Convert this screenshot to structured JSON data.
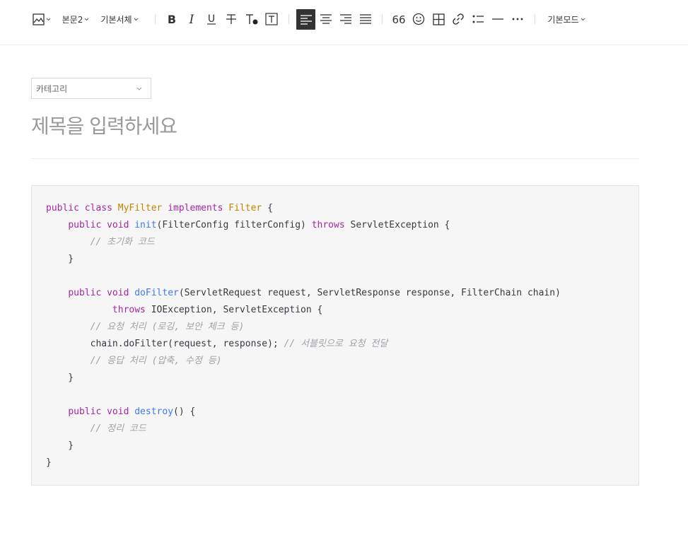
{
  "toolbar": {
    "image_label": "image",
    "paragraph_style": "본문2",
    "font_family": "기본서체",
    "mode": "기본모드",
    "more_label": "···"
  },
  "editor": {
    "category_label": "카테고리",
    "title_placeholder": "제목을 입력하세요"
  },
  "code": {
    "lines": [
      [
        [
          "kw",
          "public class "
        ],
        [
          "cls",
          "MyFilter "
        ],
        [
          "kw",
          "implements "
        ],
        [
          "cls",
          "Filter "
        ],
        [
          "pl",
          "{"
        ]
      ],
      [
        [
          "pl",
          "    "
        ],
        [
          "kw",
          "public void "
        ],
        [
          "fn",
          "init"
        ],
        [
          "pl",
          "(FilterConfig filterConfig) "
        ],
        [
          "kw",
          "throws "
        ],
        [
          "pl",
          "ServletException {"
        ]
      ],
      [
        [
          "pl",
          "        "
        ],
        [
          "cm",
          "// 초기화 코드"
        ]
      ],
      [
        [
          "pl",
          "    }"
        ]
      ],
      [
        [
          "pl",
          ""
        ]
      ],
      [
        [
          "pl",
          "    "
        ],
        [
          "kw",
          "public void "
        ],
        [
          "fn",
          "doFilter"
        ],
        [
          "pl",
          "(ServletRequest request, ServletResponse response, FilterChain chain)"
        ]
      ],
      [
        [
          "pl",
          "            "
        ],
        [
          "kw",
          "throws "
        ],
        [
          "pl",
          "IOException, ServletException {"
        ]
      ],
      [
        [
          "pl",
          "        "
        ],
        [
          "cm",
          "// 요청 처리 (로깅, 보안 체크 등)"
        ]
      ],
      [
        [
          "pl",
          "        chain.doFilter(request, response); "
        ],
        [
          "cm",
          "// 서블릿으로 요청 전달"
        ]
      ],
      [
        [
          "pl",
          "        "
        ],
        [
          "cm",
          "// 응답 처리 (압축, 수정 등)"
        ]
      ],
      [
        [
          "pl",
          "    }"
        ]
      ],
      [
        [
          "pl",
          ""
        ]
      ],
      [
        [
          "pl",
          "    "
        ],
        [
          "kw",
          "public void "
        ],
        [
          "fn",
          "destroy"
        ],
        [
          "pl",
          "() {"
        ]
      ],
      [
        [
          "pl",
          "        "
        ],
        [
          "cm",
          "// 정리 코드"
        ]
      ],
      [
        [
          "pl",
          "    }"
        ]
      ],
      [
        [
          "pl",
          "}"
        ]
      ]
    ]
  }
}
